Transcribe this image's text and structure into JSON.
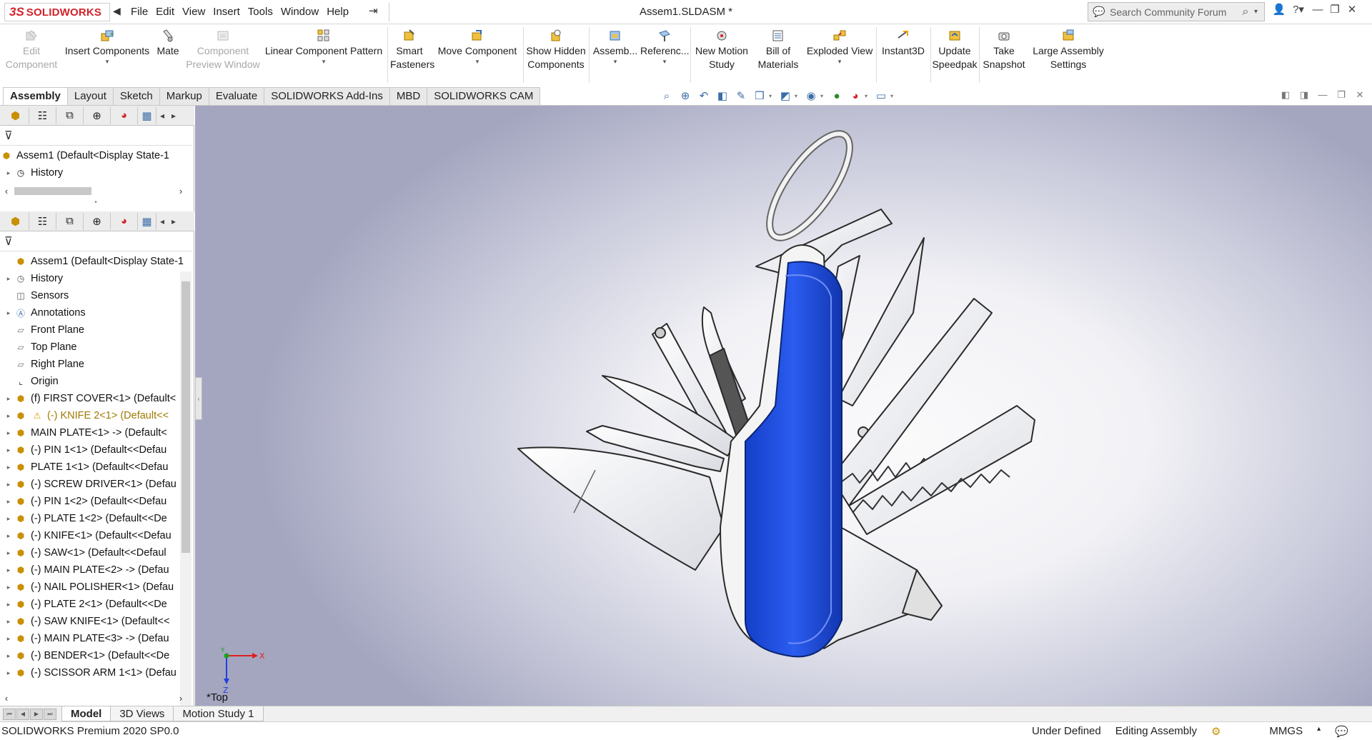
{
  "window": {
    "document_title": "Assem1.SLDASM *",
    "logo_text": "SOLIDWORKS",
    "logo_mark": "3S"
  },
  "menu": [
    "File",
    "Edit",
    "View",
    "Insert",
    "Tools",
    "Window",
    "Help"
  ],
  "search": {
    "placeholder": "Search Community Forum"
  },
  "commands": [
    {
      "label1": "Edit",
      "label2": "Component",
      "enabled": false,
      "icon": "edit-component-icon"
    },
    {
      "label1": "Insert Components",
      "label2": "",
      "enabled": true,
      "icon": "insert-components-icon",
      "dropdown": true
    },
    {
      "label1": "Mate",
      "label2": "",
      "enabled": true,
      "icon": "mate-icon"
    },
    {
      "label1": "Component",
      "label2": "Preview Window",
      "enabled": false,
      "icon": "preview-window-icon"
    },
    {
      "label1": "Linear Component Pattern",
      "label2": "",
      "enabled": true,
      "icon": "linear-pattern-icon",
      "dropdown": true
    },
    {
      "label1": "Smart",
      "label2": "Fasteners",
      "enabled": true,
      "icon": "smart-fasteners-icon"
    },
    {
      "label1": "Move Component",
      "label2": "",
      "enabled": true,
      "icon": "move-component-icon",
      "dropdown": true
    },
    {
      "label1": "Show Hidden",
      "label2": "Components",
      "enabled": true,
      "icon": "show-hidden-icon"
    },
    {
      "label1": "Assemb...",
      "label2": "",
      "enabled": true,
      "icon": "assembly-features-icon",
      "dropdown": true
    },
    {
      "label1": "Referenc...",
      "label2": "",
      "enabled": true,
      "icon": "reference-geometry-icon",
      "dropdown": true
    },
    {
      "label1": "New Motion",
      "label2": "Study",
      "enabled": true,
      "icon": "motion-study-icon"
    },
    {
      "label1": "Bill of",
      "label2": "Materials",
      "enabled": true,
      "icon": "bom-icon"
    },
    {
      "label1": "Exploded View",
      "label2": "",
      "enabled": true,
      "icon": "exploded-view-icon",
      "dropdown": true
    },
    {
      "label1": "Instant3D",
      "label2": "",
      "enabled": true,
      "icon": "instant3d-icon"
    },
    {
      "label1": "Update",
      "label2": "Speedpak",
      "enabled": true,
      "icon": "speedpak-icon"
    },
    {
      "label1": "Take",
      "label2": "Snapshot",
      "enabled": true,
      "icon": "snapshot-icon"
    },
    {
      "label1": "Large Assembly",
      "label2": "Settings",
      "enabled": true,
      "icon": "large-assembly-icon"
    }
  ],
  "tabs": [
    "Assembly",
    "Layout",
    "Sketch",
    "Markup",
    "Evaluate",
    "SOLIDWORKS Add-Ins",
    "MBD",
    "SOLIDWORKS CAM"
  ],
  "active_tab": "Assembly",
  "tree_top": [
    {
      "label": "Assem1  (Default<Display State-1",
      "icon": "assembly-icon",
      "expander": ""
    },
    {
      "label": "History",
      "icon": "history-icon",
      "expander": "▸"
    }
  ],
  "tree_main": [
    {
      "label": "Assem1  (Default<Display State-1",
      "icon": "assembly-icon",
      "expander": ""
    },
    {
      "label": "History",
      "icon": "history-icon",
      "expander": "▸"
    },
    {
      "label": "Sensors",
      "icon": "sensors-icon",
      "expander": ""
    },
    {
      "label": "Annotations",
      "icon": "annotations-icon",
      "expander": "▸"
    },
    {
      "label": "Front Plane",
      "icon": "plane-icon",
      "expander": ""
    },
    {
      "label": "Top Plane",
      "icon": "plane-icon",
      "expander": ""
    },
    {
      "label": "Right Plane",
      "icon": "plane-icon",
      "expander": ""
    },
    {
      "label": "Origin",
      "icon": "origin-icon",
      "expander": ""
    },
    {
      "label": "(f) FIRST COVER<1> (Default<",
      "icon": "part-icon",
      "expander": "▸"
    },
    {
      "label": "(-) KNIFE 2<1> (Default<<",
      "icon": "part-icon",
      "expander": "▸",
      "warning": true
    },
    {
      "label": "MAIN PLATE<1> -> (Default<",
      "icon": "part-icon",
      "expander": "▸"
    },
    {
      "label": "(-) PIN 1<1> (Default<<Defau",
      "icon": "part-icon",
      "expander": "▸"
    },
    {
      "label": "PLATE 1<1> (Default<<Defau",
      "icon": "part-icon",
      "expander": "▸"
    },
    {
      "label": "(-) SCREW DRIVER<1> (Defau",
      "icon": "part-icon",
      "expander": "▸"
    },
    {
      "label": "(-) PIN 1<2> (Default<<Defau",
      "icon": "part-icon",
      "expander": "▸"
    },
    {
      "label": "(-) PLATE 1<2> (Default<<De",
      "icon": "part-icon",
      "expander": "▸"
    },
    {
      "label": "(-) KNIFE<1> (Default<<Defau",
      "icon": "part-icon",
      "expander": "▸"
    },
    {
      "label": "(-) SAW<1> (Default<<Defaul",
      "icon": "part-icon",
      "expander": "▸"
    },
    {
      "label": "(-) MAIN PLATE<2> -> (Defau",
      "icon": "part-icon",
      "expander": "▸"
    },
    {
      "label": "(-) NAIL POLISHER<1> (Defau",
      "icon": "part-icon",
      "expander": "▸"
    },
    {
      "label": "(-) PLATE 2<1> (Default<<De",
      "icon": "part-icon",
      "expander": "▸"
    },
    {
      "label": "(-) SAW KNIFE<1> (Default<<",
      "icon": "part-icon",
      "expander": "▸"
    },
    {
      "label": "(-) MAIN PLATE<3> -> (Defau",
      "icon": "part-icon",
      "expander": "▸"
    },
    {
      "label": "(-) BENDER<1> (Default<<De",
      "icon": "part-icon",
      "expander": "▸"
    },
    {
      "label": "(-) SCISSOR ARM 1<1> (Defau",
      "icon": "part-icon",
      "expander": "▸"
    }
  ],
  "graphics": {
    "view_label": "*Top",
    "triad_x": "X",
    "triad_y": "Y",
    "triad_z": "Z",
    "handle_color": "#1f4fd6"
  },
  "bottom_tabs": [
    "Model",
    "3D Views",
    "Motion Study 1"
  ],
  "active_bottom_tab": "Model",
  "status": {
    "product": "SOLIDWORKS Premium 2020 SP0.0",
    "state": "Under Defined",
    "mode": "Editing Assembly",
    "units": "MMGS"
  },
  "colors": {
    "accent": "#d2232a",
    "handle": "#1f4fd6"
  }
}
